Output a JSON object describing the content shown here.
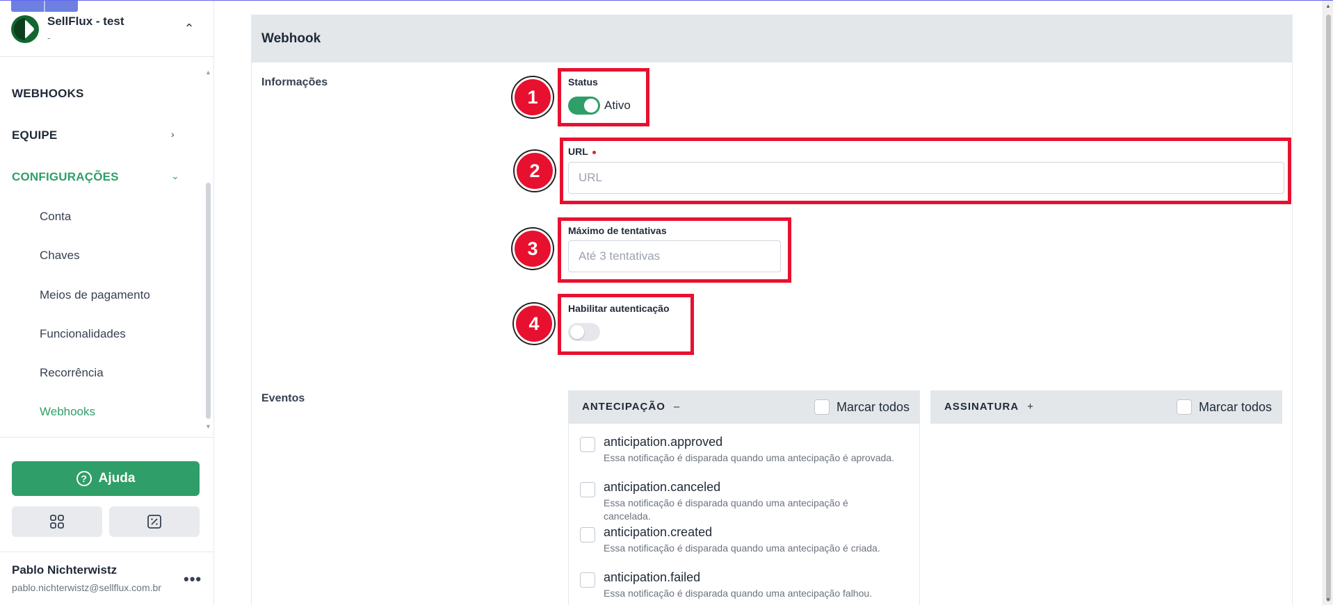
{
  "sidebar": {
    "org_name": "SellFlux - test",
    "org_sub": "-",
    "nav": [
      {
        "label": "WEBHOOKS"
      },
      {
        "label": "EQUIPE"
      },
      {
        "label": "CONFIGURAÇÕES"
      }
    ],
    "sub_items": [
      {
        "label": "Conta"
      },
      {
        "label": "Chaves"
      },
      {
        "label": "Meios de pagamento"
      },
      {
        "label": "Funcionalidades"
      },
      {
        "label": "Recorrência"
      },
      {
        "label": "Webhooks"
      }
    ],
    "help_label": "Ajuda",
    "user_name": "Pablo Nichterwistz",
    "user_email": "pablo.nichterwistz@sellflux.com.br",
    "accent_color": "#2f9e68"
  },
  "main": {
    "title": "Webhook",
    "section_info": "Informações",
    "section_events": "Eventos",
    "status": {
      "label": "Status",
      "value": "Ativo",
      "enabled": true
    },
    "url": {
      "label": "URL",
      "placeholder": "URL",
      "value": ""
    },
    "max_attempts": {
      "label": "Máximo de tentativas",
      "placeholder": "Até 3 tentativas",
      "value": ""
    },
    "auth": {
      "label": "Habilitar autenticação",
      "enabled": false
    },
    "callouts": [
      "1",
      "2",
      "3",
      "4"
    ],
    "highlight_color": "#e8102f",
    "events": [
      {
        "title": "ANTECIPAÇÃO",
        "toggle": "–",
        "check_all": "Marcar todos",
        "items": [
          {
            "name": "anticipation.approved",
            "desc": "Essa notificação é disparada quando uma antecipação é aprovada."
          },
          {
            "name": "anticipation.canceled",
            "desc": "Essa notificação é disparada quando uma antecipação é cancelada."
          },
          {
            "name": "anticipation.created",
            "desc": "Essa notificação é disparada quando uma antecipação é criada."
          },
          {
            "name": "anticipation.failed",
            "desc": "Essa notificação é disparada quando uma antecipação falhou."
          }
        ]
      },
      {
        "title": "ASSINATURA",
        "toggle": "+",
        "check_all": "Marcar todos",
        "items": []
      }
    ]
  }
}
